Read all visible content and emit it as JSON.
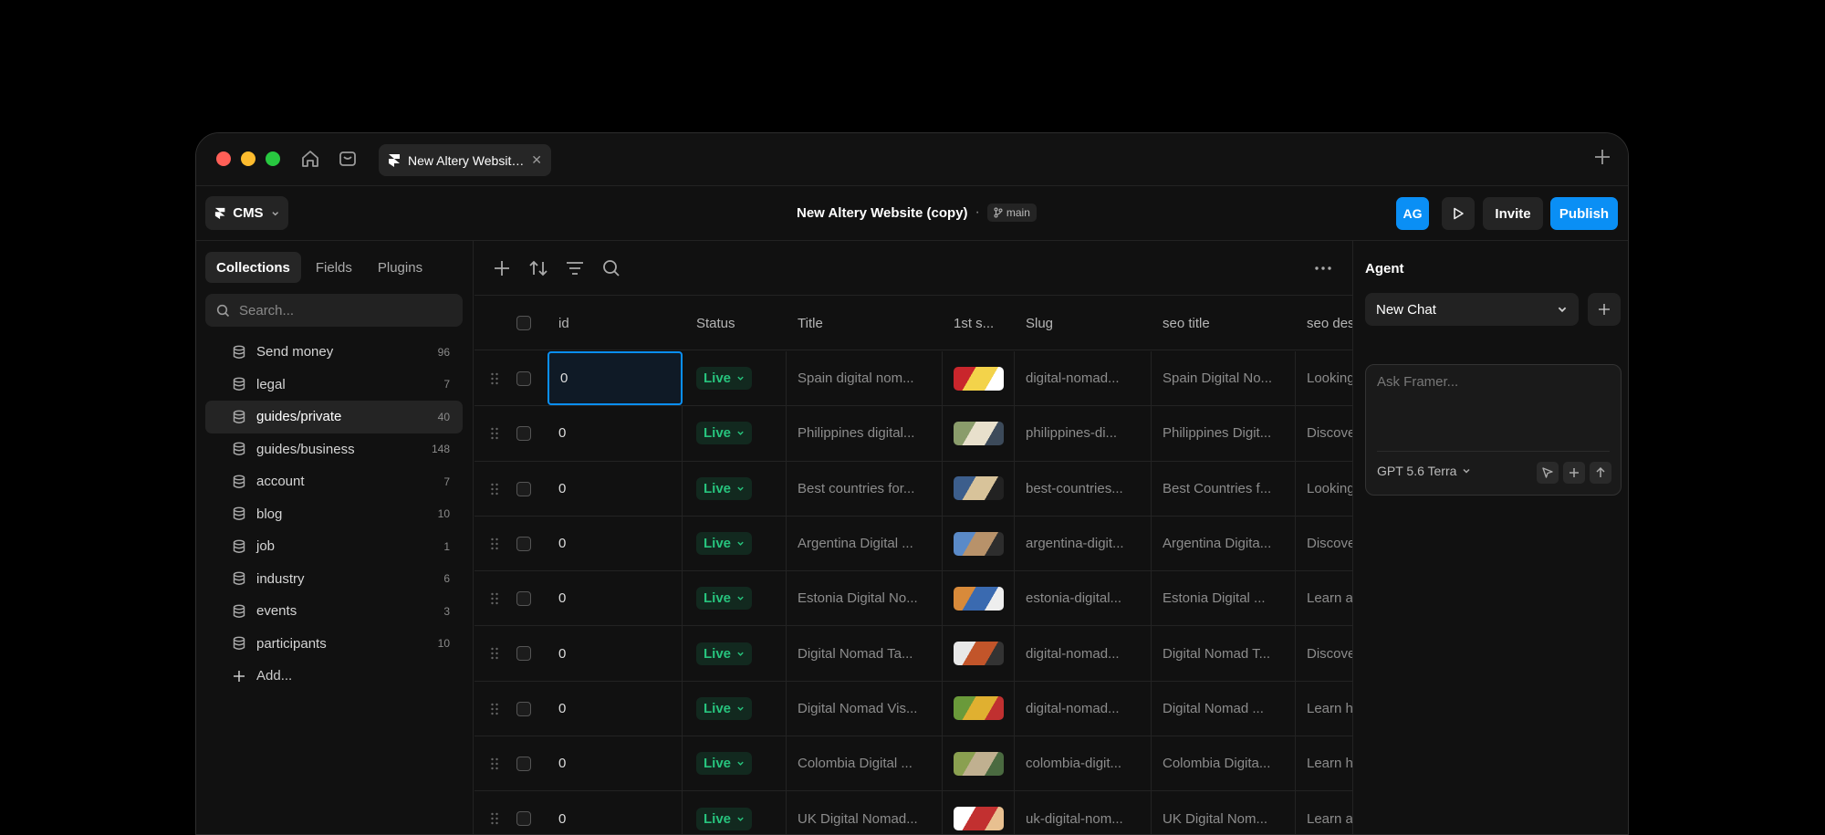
{
  "window": {
    "tab_title": "New Altery Website (copy)",
    "colors": {
      "accent": "#0a8ff5",
      "live_text": "#27c37d",
      "live_bg": "#12291f"
    }
  },
  "topbar": {
    "mode_label": "CMS",
    "project_title": "New Altery Website (copy)",
    "separator": "·",
    "branch": "main",
    "avatar_initials": "AG",
    "invite_label": "Invite",
    "publish_label": "Publish"
  },
  "sidebar": {
    "tabs": [
      {
        "label": "Collections",
        "active": true
      },
      {
        "label": "Fields",
        "active": false
      },
      {
        "label": "Plugins",
        "active": false
      }
    ],
    "search_placeholder": "Search...",
    "collections": [
      {
        "name": "Send money",
        "count": "96"
      },
      {
        "name": "legal",
        "count": "7"
      },
      {
        "name": "guides/private",
        "count": "40",
        "selected": true
      },
      {
        "name": "guides/business",
        "count": "148"
      },
      {
        "name": "account",
        "count": "7"
      },
      {
        "name": "blog",
        "count": "10"
      },
      {
        "name": "job",
        "count": "1"
      },
      {
        "name": "industry",
        "count": "6"
      },
      {
        "name": "events",
        "count": "3"
      },
      {
        "name": "participants",
        "count": "10"
      }
    ],
    "add_label": "Add..."
  },
  "table": {
    "columns": [
      "id",
      "Status",
      "Title",
      "1st s...",
      "Slug",
      "seo title",
      "seo des"
    ],
    "rows": [
      {
        "id": "0",
        "status": "Live",
        "title": "Spain digital nom...",
        "slug": "digital-nomad...",
        "seo_title": "Spain Digital No...",
        "seo_desc": "Looking"
      },
      {
        "id": "0",
        "status": "Live",
        "title": "Philippines digital...",
        "slug": "philippines-di...",
        "seo_title": "Philippines Digit...",
        "seo_desc": "Discove"
      },
      {
        "id": "0",
        "status": "Live",
        "title": "Best countries for...",
        "slug": "best-countries...",
        "seo_title": "Best Countries f...",
        "seo_desc": "Looking"
      },
      {
        "id": "0",
        "status": "Live",
        "title": "Argentina Digital ...",
        "slug": "argentina-digit...",
        "seo_title": "Argentina Digita...",
        "seo_desc": "Discove"
      },
      {
        "id": "0",
        "status": "Live",
        "title": "Estonia Digital No...",
        "slug": "estonia-digital...",
        "seo_title": "Estonia Digital ...",
        "seo_desc": "Learn a"
      },
      {
        "id": "0",
        "status": "Live",
        "title": "Digital Nomad Ta...",
        "slug": "digital-nomad...",
        "seo_title": "Digital Nomad T...",
        "seo_desc": "Discove"
      },
      {
        "id": "0",
        "status": "Live",
        "title": "Digital Nomad Vis...",
        "slug": "digital-nomad...",
        "seo_title": "Digital Nomad ...",
        "seo_desc": "Learn h"
      },
      {
        "id": "0",
        "status": "Live",
        "title": "Colombia Digital ...",
        "slug": "colombia-digit...",
        "seo_title": "Colombia Digita...",
        "seo_desc": "Learn h"
      },
      {
        "id": "0",
        "status": "Live",
        "title": "UK Digital Nomad...",
        "slug": "uk-digital-nom...",
        "seo_title": "UK Digital Nom...",
        "seo_desc": "Learn a"
      }
    ]
  },
  "agent": {
    "title": "Agent",
    "chat_select": "New Chat",
    "input_placeholder": "Ask Framer...",
    "model": "GPT 5.6 Terra"
  }
}
